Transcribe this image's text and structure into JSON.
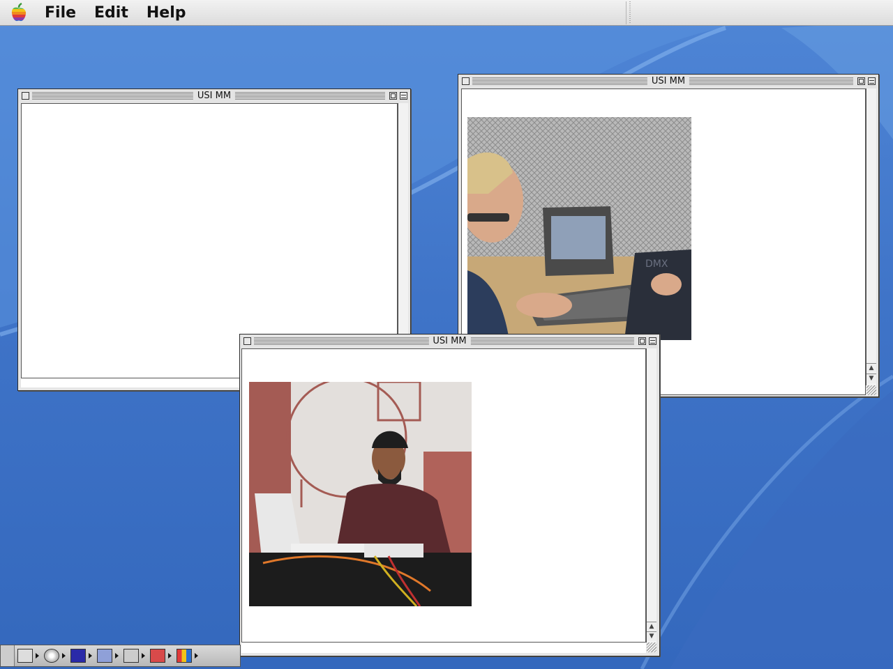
{
  "menubar": {
    "apple_icon": "apple-rainbow-icon",
    "items": [
      "File",
      "Edit",
      "Help"
    ]
  },
  "windows": [
    {
      "title": "USI MM"
    },
    {
      "title": "USI MM"
    },
    {
      "title": "USI MM"
    }
  ],
  "photos": {
    "right_window": "photo of a man with glasses typing on a vintage laptop next to a DMX lighting controller",
    "front_window": "photo of a bearded man at a table with a laptop and cables, diagram drawn on wall behind"
  },
  "controlstrip": {
    "modules": [
      "monitor-icon",
      "cd-icon",
      "sleep-moon-icon",
      "file-sharing-icon",
      "keychain-lock-icon",
      "remote-access-icon",
      "color-depth-icon"
    ]
  },
  "colors": {
    "desktop": "#3f74c8",
    "window_frame": "#e6e6e6",
    "content_bg": "#ffffff"
  }
}
